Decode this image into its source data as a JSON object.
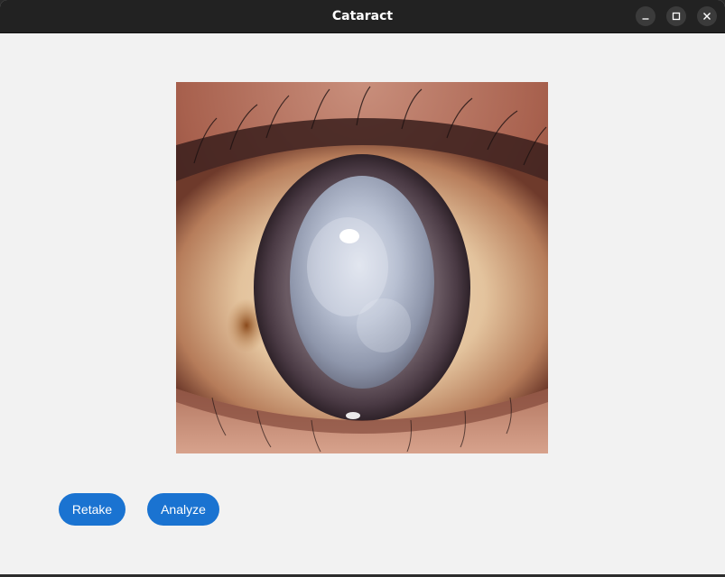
{
  "window": {
    "title": "Cataract",
    "controls": {
      "minimize_icon": "minimize-icon",
      "maximize_icon": "maximize-icon",
      "close_icon": "close-icon"
    }
  },
  "main": {
    "image": {
      "subject": "close-up of eye with cataract (cloudy white lens)",
      "icon": "eye-photo"
    },
    "buttons": {
      "retake_label": "Retake",
      "analyze_label": "Analyze"
    }
  },
  "colors": {
    "titlebar": "#222222",
    "background": "#f2f2f2",
    "button": "#1a73d1",
    "button_text": "#ffffff"
  }
}
